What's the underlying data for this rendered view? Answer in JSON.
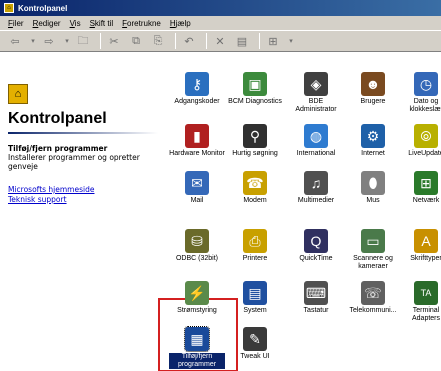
{
  "window": {
    "title": "Kontrolpanel"
  },
  "menu": [
    "Filer",
    "Rediger",
    "Vis",
    "Skift til",
    "Foretrukne",
    "Hjælp"
  ],
  "left_pane": {
    "title": "Kontrolpanel",
    "heading": "Tilføj/fjern programmer",
    "description": "Installerer programmer og opretter genveje",
    "links": [
      "Microsofts hjemmeside",
      "Teknisk support"
    ]
  },
  "items": [
    {
      "label": "Adgangskoder",
      "icon": "keys-icon",
      "color": "#2a6fbf",
      "glyph": "⚷"
    },
    {
      "label": "BCM Diagnostics",
      "icon": "diagnostics-icon",
      "color": "#3c8a3c",
      "glyph": "▣"
    },
    {
      "label": "BDE Administrator",
      "icon": "bde-admin-icon",
      "color": "#404040",
      "glyph": "◈"
    },
    {
      "label": "Brugere",
      "icon": "users-icon",
      "color": "#7a4a20",
      "glyph": "☻"
    },
    {
      "label": "Dato og klokkeslæt",
      "icon": "clock-icon",
      "color": "#3468b8",
      "glyph": "◷"
    },
    {
      "label": "Hardware Monitor",
      "icon": "hardware-monitor-icon",
      "color": "#b02020",
      "glyph": "▮"
    },
    {
      "label": "Hurtig søgning",
      "icon": "search-icon",
      "color": "#303030",
      "glyph": "⚲"
    },
    {
      "label": "International",
      "icon": "globe-icon",
      "color": "#2e7bd0",
      "glyph": "◍"
    },
    {
      "label": "Internet",
      "icon": "internet-icon",
      "color": "#1e60a8",
      "glyph": "⚙"
    },
    {
      "label": "LiveUpdate",
      "icon": "liveupdate-icon",
      "color": "#b8b000",
      "glyph": "⦾"
    },
    {
      "label": "Mail",
      "icon": "mail-icon",
      "color": "#3468b8",
      "glyph": "✉"
    },
    {
      "label": "Modem",
      "icon": "modem-icon",
      "color": "#c8a000",
      "glyph": "☎"
    },
    {
      "label": "Multimedier",
      "icon": "multimedia-icon",
      "color": "#505050",
      "glyph": "♫"
    },
    {
      "label": "Mus",
      "icon": "mouse-icon",
      "color": "#808080",
      "glyph": "⬮"
    },
    {
      "label": "Netværk",
      "icon": "network-icon",
      "color": "#2a7a2a",
      "glyph": "⊞"
    },
    {
      "label": "ODBC (32bit)",
      "icon": "odbc-icon",
      "color": "#6a6a2a",
      "glyph": "⛁"
    },
    {
      "label": "Printere",
      "icon": "printer-icon",
      "color": "#c8a000",
      "glyph": "⎙"
    },
    {
      "label": "QuickTime",
      "icon": "quicktime-icon",
      "color": "#303060",
      "glyph": "Q"
    },
    {
      "label": "Scannere og kameraer",
      "icon": "scanner-icon",
      "color": "#4a7a4a",
      "glyph": "▭"
    },
    {
      "label": "Skrifttyper",
      "icon": "fonts-icon",
      "color": "#c89000",
      "glyph": "A"
    },
    {
      "label": "Strømstyring",
      "icon": "power-icon",
      "color": "#5a8a4a",
      "glyph": "⚡"
    },
    {
      "label": "System",
      "icon": "system-icon",
      "color": "#2050a0",
      "glyph": "▤"
    },
    {
      "label": "Tastatur",
      "icon": "keyboard-icon",
      "color": "#505050",
      "glyph": "⌨"
    },
    {
      "label": "Telekommuni...",
      "icon": "telecom-icon",
      "color": "#606060",
      "glyph": "☏"
    },
    {
      "label": "Terminal Adapters",
      "icon": "terminal-adapter-icon",
      "color": "#2a6a2a",
      "glyph": "TA"
    },
    {
      "label": "Tilføj/fjern programmer",
      "icon": "add-remove-programs-icon",
      "color": "#1a4a9a",
      "glyph": "▦"
    },
    {
      "label": "Tweak UI",
      "icon": "tweak-ui-icon",
      "color": "#3a3a3a",
      "glyph": "✎"
    }
  ]
}
